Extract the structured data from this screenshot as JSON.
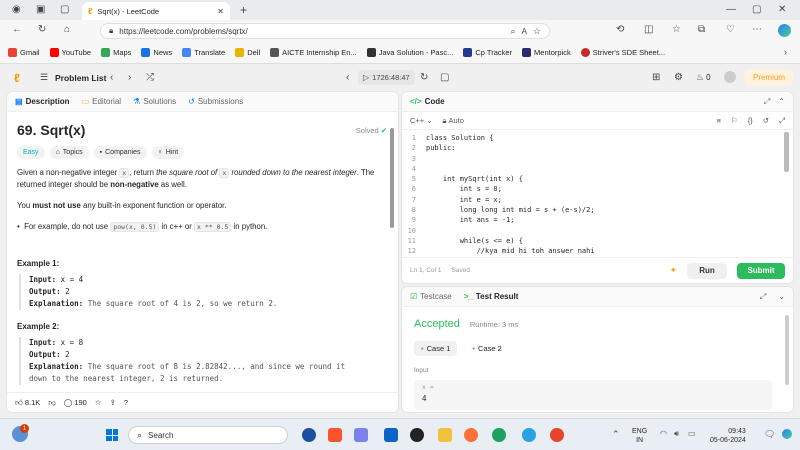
{
  "browser": {
    "tab_title": "Sqrt(x) - LeetCode",
    "url": "https://leetcode.com/problems/sqrtx/",
    "bookmarks": [
      {
        "label": "Gmail",
        "color": "#ea4335"
      },
      {
        "label": "YouTube",
        "color": "#ff0000"
      },
      {
        "label": "Maps",
        "color": "#34a853"
      },
      {
        "label": "News",
        "color": "#1a73e8"
      },
      {
        "label": "Translate",
        "color": "#4285f4"
      },
      {
        "label": "Dell",
        "color": "#e8b400"
      },
      {
        "label": "AICTE Internship En...",
        "color": "#555555"
      },
      {
        "label": "Java Solution - Pasc...",
        "color": "#333333"
      },
      {
        "label": "Cp Tracker",
        "color": "#1f3b8f"
      },
      {
        "label": "Mentorpick",
        "color": "#2a2a6e"
      },
      {
        "label": "Striver's SDE Sheet...",
        "color": "#c62828"
      }
    ]
  },
  "header": {
    "problem_list": "Problem List",
    "timer": "1726:48:47",
    "streak": "0",
    "premium": "Premium"
  },
  "description": {
    "tabs": [
      "Description",
      "Editorial",
      "Solutions",
      "Submissions"
    ],
    "title": "69. Sqrt(x)",
    "status": "Solved",
    "tags": [
      "Easy",
      "Topics",
      "Companies",
      "Hint"
    ],
    "p1_a": "Given a non-negative integer ",
    "p1_code": "x",
    "p1_b": ", return ",
    "p1_em1": "the square root of ",
    "p1_code2": "x",
    "p1_em2": " rounded down to the nearest integer",
    "p1_c": ". The returned integer should be ",
    "p1_strong": "non-negative",
    "p1_d": " as well.",
    "p2_a": "You ",
    "p2_strong": "must not use",
    "p2_b": " any built-in exponent function or operator.",
    "bullet_a": "For example, do not use ",
    "bullet_code1": "pow(x, 0.5)",
    "bullet_b": " in c++ or ",
    "bullet_code2": "x ** 0.5",
    "bullet_c": " in python.",
    "ex1_title": "Example 1:",
    "ex1_input_label": "Input:",
    "ex1_input": " x = 4",
    "ex1_output_label": "Output:",
    "ex1_output": " 2",
    "ex1_expl_label": "Explanation:",
    "ex1_expl": " The square root of 4 is 2, so we return 2.",
    "ex2_title": "Example 2:",
    "ex2_input_label": "Input:",
    "ex2_input": " x = 8",
    "ex2_output_label": "Output:",
    "ex2_output": " 2",
    "ex2_expl_label": "Explanation:",
    "ex2_expl": " The square root of 8 is 2.82842..., and since we round it",
    "ex2_expl2": "down to the nearest integer, 2 is returned.",
    "likes": "8.1K",
    "comments": "190"
  },
  "code": {
    "title": "Code",
    "language": "C++",
    "mode": "Auto",
    "lines": [
      "class Solution {",
      "public:",
      "",
      "",
      "    int mySqrt(int x) {",
      "        int s = 0;",
      "        int e = x;",
      "        long long int mid = s + (e-s)/2;",
      "        int ans = -1;",
      "",
      "        while(s <= e) {",
      "            //kya mid hi toh answer nahi"
    ],
    "cursor": "Ln 1, Col 1",
    "saved": "Saved",
    "run": "Run",
    "submit": "Submit"
  },
  "result": {
    "tabs": [
      "Testcase",
      "Test Result"
    ],
    "status": "Accepted",
    "runtime": "Runtime: 3 ms",
    "cases": [
      "Case 1",
      "Case 2"
    ],
    "input_label": "Input",
    "var_name": "x =",
    "var_value": "4"
  },
  "taskbar": {
    "search": "Search",
    "lang1": "ENG",
    "lang2": "IN",
    "time": "09:43",
    "date": "05-06-2024",
    "badge": "1"
  },
  "colors": {
    "accent_green": "#2cbb5d",
    "orange": "#ffa116",
    "easy": "#00b8a3",
    "blue": "#007aff"
  }
}
